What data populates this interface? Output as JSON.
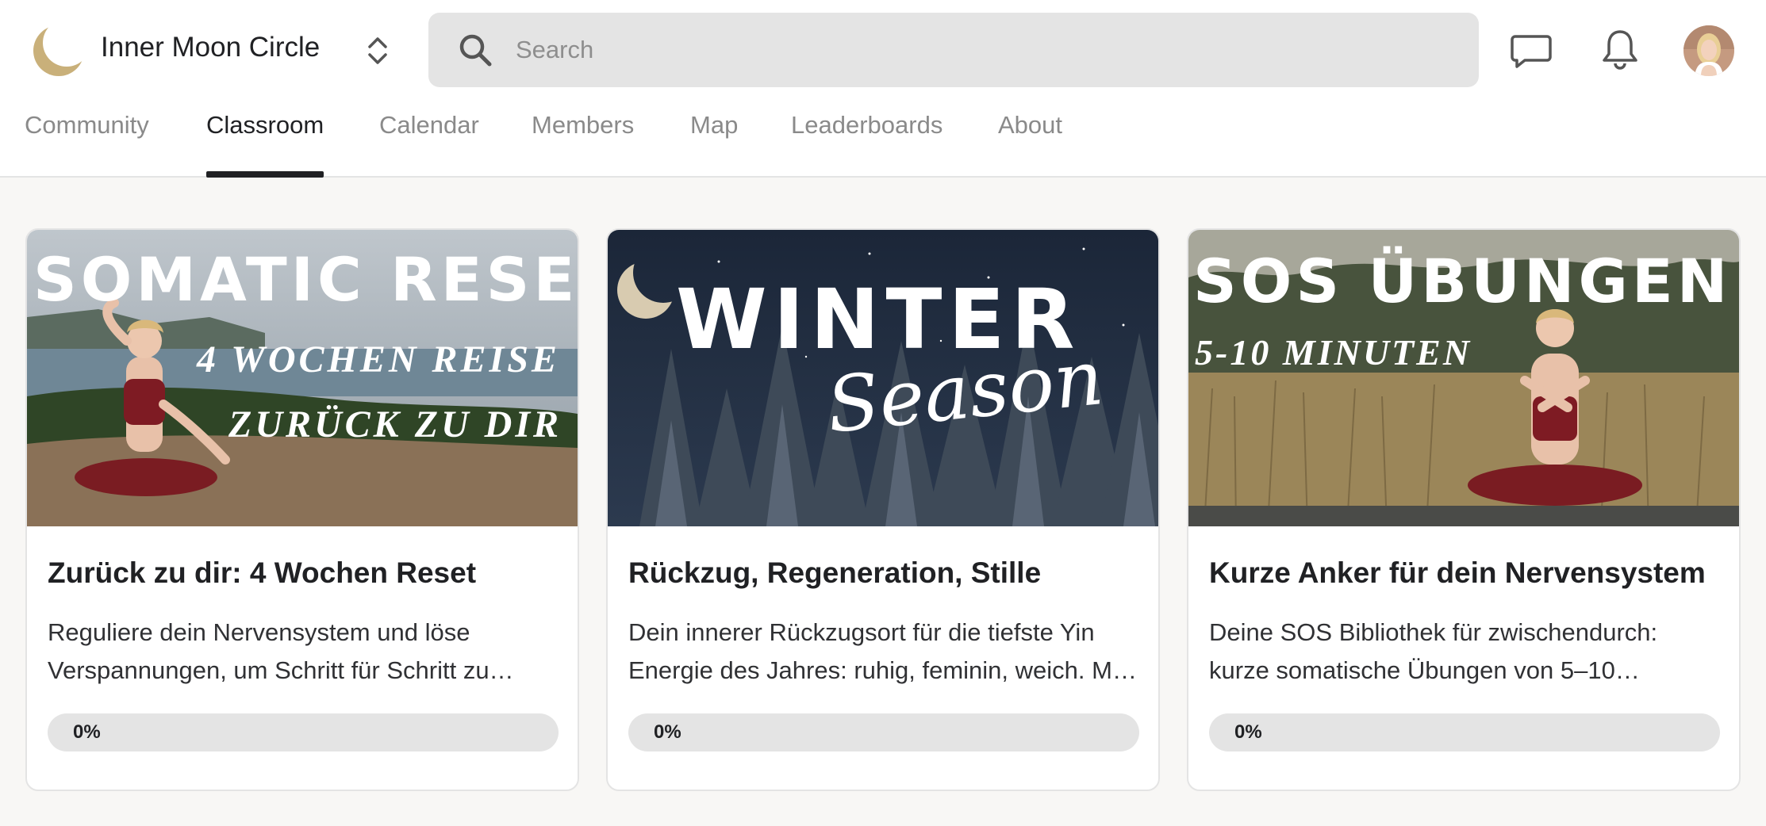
{
  "brand": {
    "name": "Inner Moon Circle",
    "accent": "#c9b892"
  },
  "search": {
    "placeholder": "Search"
  },
  "tabs": [
    {
      "label": "Community",
      "active": false
    },
    {
      "label": "Classroom",
      "active": true
    },
    {
      "label": "Calendar",
      "active": false
    },
    {
      "label": "Members",
      "active": false
    },
    {
      "label": "Map",
      "active": false
    },
    {
      "label": "Leaderboards",
      "active": false
    },
    {
      "label": "About",
      "active": false
    }
  ],
  "header_icons": [
    "moon-logo-icon",
    "chevron-updown-icon",
    "search-icon",
    "chat-icon",
    "bell-icon"
  ],
  "courses": [
    {
      "cover_line1": "SOMATIC RESET",
      "cover_line2": "4 WOCHEN REISE",
      "cover_line3": "ZURÜCK ZU DIR",
      "title": "Zurück zu dir: 4 Wochen Reset",
      "description": "Reguliere dein Nervensystem und löse Verspannungen, um Schritt für Schritt zu…",
      "progress": 0,
      "progress_label": "0%"
    },
    {
      "cover_line1": "WINTER",
      "cover_line2": "Season",
      "title": "Rückzug, Regeneration, Stille",
      "description": "Dein innerer Rückzugsort für die tiefste Yin Energie des Jahres: ruhig, feminin, weich. M…",
      "progress": 0,
      "progress_label": "0%"
    },
    {
      "cover_line1": "SOS ÜBUNGEN",
      "cover_line2": "5-10 MINUTEN",
      "title": "Kurze Anker für dein Nervensystem",
      "description": "Deine SOS Bibliothek für zwischendurch: kurze somatische Übungen von 5–10…",
      "progress": 0,
      "progress_label": "0%"
    }
  ]
}
